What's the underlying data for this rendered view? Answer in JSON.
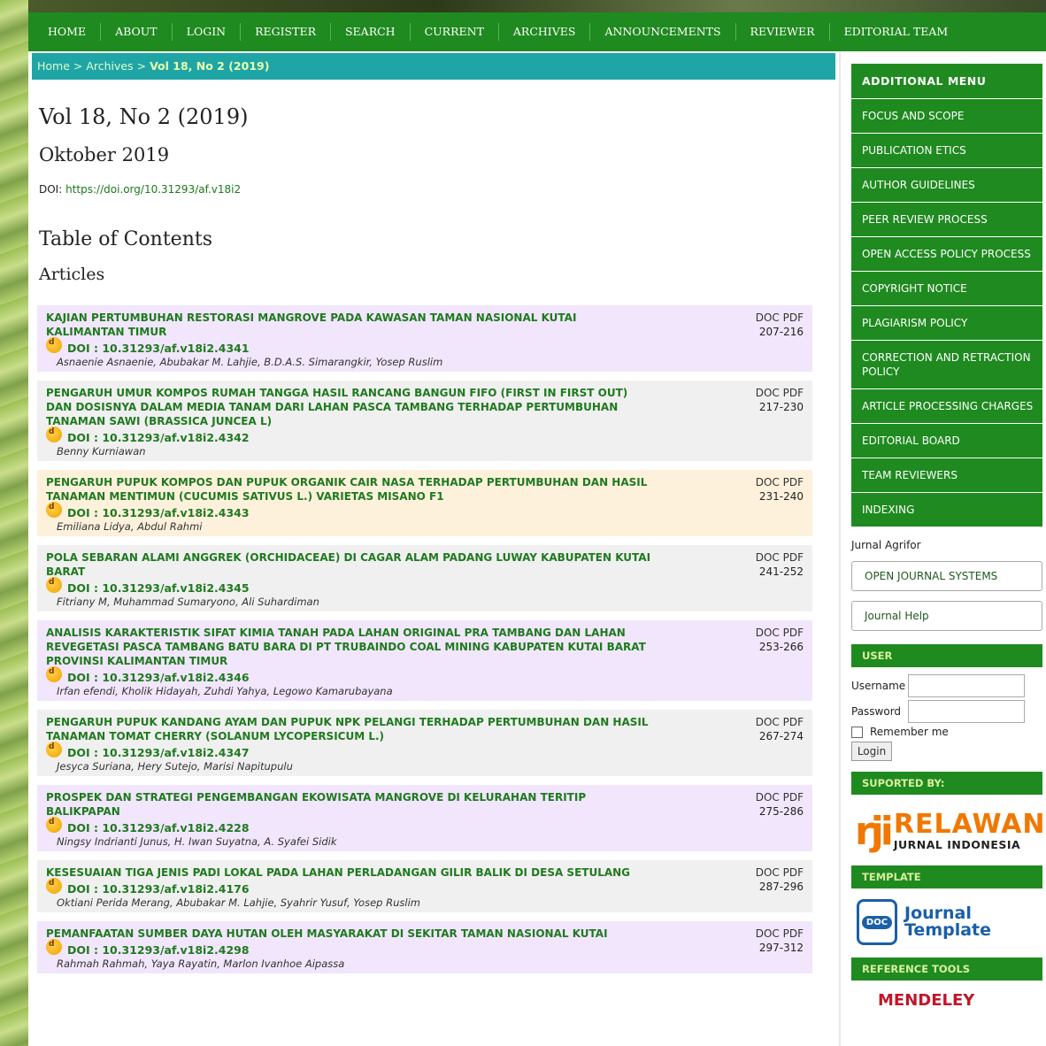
{
  "nav": [
    "HOME",
    "ABOUT",
    "LOGIN",
    "REGISTER",
    "SEARCH",
    "CURRENT",
    "ARCHIVES",
    "ANNOUNCEMENTS",
    "REVIEWER",
    "EDITORIAL TEAM"
  ],
  "breadcrumb": {
    "home": "Home",
    "sep1": " > ",
    "archives": "Archives",
    "sep2": " > ",
    "current": "Vol 18, No 2 (2019)"
  },
  "issue": {
    "title": "Vol 18, No 2 (2019)",
    "date": "Oktober 2019",
    "doi_label": "DOI: ",
    "doi_link": "https://doi.org/10.31293/af.v18i2",
    "toc_title": "Table of Contents",
    "section": "Articles"
  },
  "articles": [
    {
      "title": "KAJIAN PERTUMBUHAN RESTORASI MANGROVE PADA KAWASAN TAMAN NASIONAL KUTAI KALIMANTAN TIMUR",
      "doi": "DOI : 10.31293/af.v18i2.4341",
      "authors": "Asnaenie Asnaenie, Abubakar M. Lahjie, B.D.A.S. Simarangkir, Yosep Ruslim",
      "pages": "207-216"
    },
    {
      "title": "PENGARUH UMUR KOMPOS RUMAH TANGGA HASIL RANCANG BANGUN FIFO (FIRST IN FIRST OUT) DAN DOSISNYA DALAM MEDIA TANAM DARI LAHAN PASCA TAMBANG TERHADAP PERTUMBUHAN TANAMAN SAWI (Brassica juncea L)",
      "doi": "DOI : 10.31293/af.v18i2.4342",
      "authors": "Benny Kurniawan",
      "pages": "217-230"
    },
    {
      "title": "PENGARUH PUPUK KOMPOS DAN PUPUK ORGANIK CAIR NASA TERHADAP PERTUMBUHAN DAN HASIL TANAMAN MENTIMUN (Cucumis sativus L.) VARIETAS MISANO F1",
      "doi": "DOI : 10.31293/af.v18i2.4343",
      "authors": "Emiliana Lidya, Abdul Rahmi",
      "pages": "231-240"
    },
    {
      "title": "POLA SEBARAN ALAMI ANGGREK (Orchidaceae) DI CAGAR ALAM PADANG LUWAY KABUPATEN KUTAI BARAT",
      "doi": "DOI : 10.31293/af.v18i2.4345",
      "authors": "Fitriany M, Muhammad Sumaryono, Ali Suhardiman",
      "pages": "241-252"
    },
    {
      "title": "ANALISIS KARAKTERISTIK SIFAT KIMIA TANAH PADA LAHAN ORIGINAL PRA TAMBANG DAN LAHAN REVEGETASI PASCA TAMBANG BATU BARA DI PT TRUBAINDO COAL MINING KABUPATEN KUTAI BARAT PROVINSI KALIMANTAN TIMUR",
      "doi": "DOI : 10.31293/af.v18i2.4346",
      "authors": "Irfan efendi, Kholik Hidayah, Zuhdi Yahya, Legowo Kamarubayana",
      "pages": "253-266"
    },
    {
      "title": "PENGARUH PUPUK KANDANG AYAM DAN PUPUK NPK PELANGI TERHADAP PERTUMBUHAN DAN HASIL TANAMAN TOMAT CHERRY (Solanum lycopersicum L.)",
      "doi": "DOI : 10.31293/af.v18i2.4347",
      "authors": "Jesyca Suriana, Hery Sutejo, Marisi Napitupulu",
      "pages": "267-274"
    },
    {
      "title": "PROSPEK DAN STRATEGI PENGEMBANGAN EKOWISATA MANGROVE DI KELURAHAN TERITIP BALIKPAPAN",
      "doi": "DOI : 10.31293/af.v18i2.4228",
      "authors": "Ningsy Indrianti Junus, H. Iwan Suyatna, A. Syafei Sidik",
      "pages": "275-286"
    },
    {
      "title": "KESESUAIAN TIGA JENIS PADI LOKAL PADA LAHAN PERLADANGAN GILIR BALIK DI DESA SETULANG",
      "doi": "DOI : 10.31293/af.v18i2.4176",
      "authors": "Oktiani Perida Merang, Abubakar M. Lahjie, Syahrir Yusuf, Yosep Ruslim",
      "pages": "287-296"
    },
    {
      "title": "PEMANFAATAN SUMBER DAYA HUTAN OLEH MASYARAKAT DI SEKITAR TAMAN NASIONAL KUTAI",
      "doi": "DOI : 10.31293/af.v18i2.4298",
      "authors": "Rahmah Rahmah, Yaya Rayatin, Marlon Ivanhoe Aipassa",
      "pages": "297-312"
    }
  ],
  "galley_labels": {
    "doc": "DOC",
    "pdf": "PDF"
  },
  "doi_badge": "d",
  "sidebar": {
    "menu_title": "ADDITIONAL MENU",
    "menu": [
      "FOCUS AND SCOPE",
      "PUBLICATION ETICS",
      "AUTHOR GUIDELINES",
      "PEER REVIEW PROCESS",
      "OPEN ACCESS POLICY PROCESS",
      "COPYRIGHT NOTICE",
      "PLAGIARISM POLICY",
      "CORRECTION AND RETRACTION POLICY",
      "ARTICLE PROCESSING CHARGES",
      "EDITORIAL BOARD",
      "TEAM REVIEWERS",
      "INDEXING"
    ],
    "journal_name": "Jurnal Agrifor",
    "ojs_button": "OPEN JOURNAL SYSTEMS",
    "help_button": "Journal Help",
    "user_title": "USER",
    "username_label": "Username",
    "password_label": "Password",
    "remember_label": "Remember me",
    "login_button": "Login",
    "supported_title": "SUPORTED BY:",
    "rji_big": "RELAWAN",
    "rji_small": "JURNAL INDONESIA",
    "rji_mark": "rji",
    "template_title": "TEMPLATE",
    "template_doc": "DOC",
    "template_text_1": "Journal",
    "template_text_2": "Template",
    "reference_title": "REFERENCE TOOLS",
    "mendeley": "MENDELEY"
  },
  "colors": {
    "nav_green": "#1f8a1f",
    "breadcrumb_teal": "#1fa5a5",
    "title_green": "#1f7a1f",
    "orange": "#f07800"
  }
}
